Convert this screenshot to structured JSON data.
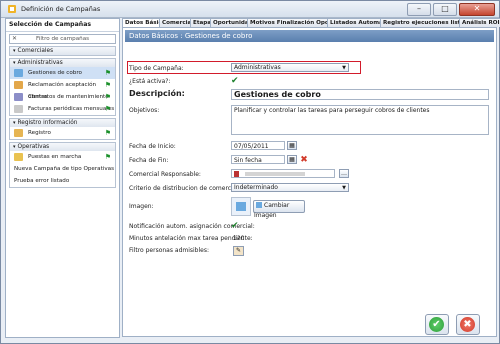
{
  "window": {
    "title": "Definición de Campañas",
    "buttons": [
      "–",
      "□",
      "✕"
    ]
  },
  "sidebar": {
    "header": "Selección de Campañas",
    "filter_placeholder": "Filtro de campañas",
    "groups": [
      {
        "title": "Comerciales",
        "items": []
      },
      {
        "title": "Administrativas",
        "items": [
          {
            "label": "Gestiones de cobro",
            "selected": true
          },
          {
            "label": "Reclamación aceptación ofertas"
          },
          {
            "label": "Contratos de mantenimiento"
          },
          {
            "label": "Facturas periódicas mensuales"
          }
        ]
      },
      {
        "title": "Registro información",
        "items": [
          {
            "label": "Registro"
          }
        ]
      },
      {
        "title": "Operativas",
        "items": [
          {
            "label": "Puestas en marcha"
          },
          {
            "label": "Nueva Campaña de tipo Operativas"
          },
          {
            "label": "Prueba error listado"
          }
        ]
      }
    ]
  },
  "tabs": [
    "Datos Básicos",
    "Comerciales",
    "Etapas",
    "Oportunidades",
    "Motivos Finalización Oportunid...",
    "Listados Automáticos",
    "Registro ejecuciones listado...",
    "Análisis ROI"
  ],
  "panel": {
    "title": "Datos Básicos : Gestiones de cobro",
    "tipo_label": "Tipo de Campaña:",
    "tipo_value": "Administrativas",
    "activa_label": "¿Está activa?:",
    "descripcion_label": "Descripción:",
    "descripcion_value": "Gestiones de cobro",
    "objetivos_label": "Objetivos:",
    "objetivos_value": "Planificar y controlar las tareas para perseguir cobros de clientes",
    "fecha_inicio_label": "Fecha de Inicio:",
    "fecha_inicio_value": "07/05/2011",
    "fecha_fin_label": "Fecha de Fin:",
    "fecha_fin_value": "Sin fecha",
    "comercial_label": "Comercial Responsable:",
    "criterio_label": "Criterio de distribucion de comerciales:",
    "criterio_value": "Indeterminado",
    "imagen_label": "Imagen:",
    "cambiar_imagen": "Cambiar Imagen",
    "notif_label": "Notificación autom. asignación comercial:",
    "minutos_label": "Minutos antelación max tarea pendiente:",
    "minutos_value": "120",
    "filtro_label": "Filtro personas admisibles:"
  },
  "colors": {
    "accent": "#5a7fae",
    "highlight": "#d21b2b",
    "ok": "#2f9e3a",
    "cancel": "#d23a2a"
  }
}
